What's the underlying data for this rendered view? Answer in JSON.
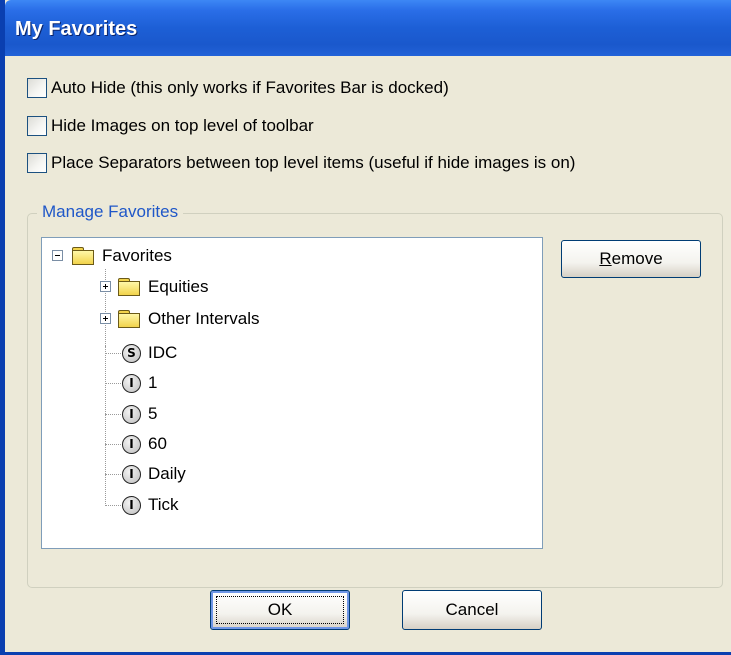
{
  "window": {
    "title": "My Favorites"
  },
  "options": [
    {
      "label": "Auto Hide (this only works if Favorites Bar is docked)",
      "checked": false
    },
    {
      "label": "Hide Images on top level of toolbar",
      "checked": false
    },
    {
      "label": "Place Separators between top level items (useful if hide images is on)",
      "checked": false
    }
  ],
  "manage": {
    "legend": "Manage Favorites",
    "tree": {
      "root": {
        "label": "Favorites",
        "icon": "folder-icon",
        "expanded": true
      },
      "folders": [
        {
          "label": "Equities",
          "icon": "folder-icon"
        },
        {
          "label": "Other Intervals",
          "icon": "folder-icon"
        }
      ],
      "items": [
        {
          "badge": "S",
          "label": "IDC"
        },
        {
          "badge": "I",
          "label": "1"
        },
        {
          "badge": "I",
          "label": "5"
        },
        {
          "badge": "I",
          "label": "60"
        },
        {
          "badge": "I",
          "label": "Daily"
        },
        {
          "badge": "I",
          "label": "Tick"
        }
      ]
    },
    "remove_button": {
      "prefix": "R",
      "rest": "emove"
    }
  },
  "footer": {
    "ok_label": "OK",
    "cancel_label": "Cancel"
  }
}
